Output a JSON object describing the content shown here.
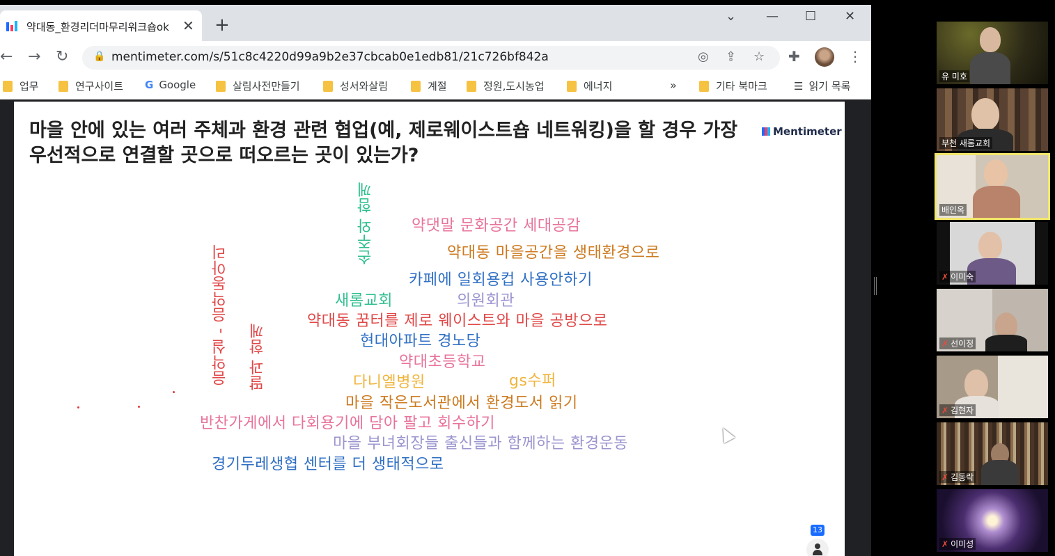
{
  "browser": {
    "tab_title": "약대동_환경리더마무리워크숍ok",
    "tab_close": "✕",
    "new_tab": "+",
    "url": "mentimeter.com/s/51c8c4220d99a9b2e37cbcab0e1edb81/21c726bf842a",
    "bookmarks": [
      {
        "label": "업무"
      },
      {
        "label": "연구사이트"
      },
      {
        "label": "Google"
      },
      {
        "label": "살림사전만들기"
      },
      {
        "label": "성서와살림"
      },
      {
        "label": "계절"
      },
      {
        "label": "정원,도시농업"
      },
      {
        "label": "에너지"
      }
    ],
    "bookmarks_more": "»",
    "other_bookmarks": "기타 북마크",
    "reading_list": "읽기 목록"
  },
  "slide": {
    "question": "마을 안에 있는 여러 주체과 환경 관련 협업(예, 제로웨이스트숍 네트워킹)을 할 경우 가장 우선적으로 연결할 곳으로 떠오르는 곳이 있는가?",
    "brand": "Mentimeter",
    "participants_count": "13",
    "words": [
      {
        "text": "약댓말 문화공간 세대공감",
        "color": "#e8739a"
      },
      {
        "text": "약대동 마을공간을 생태환경으로",
        "color": "#cc7a1f"
      },
      {
        "text": "카페에 일회용컵 사용안하기",
        "color": "#2f6fc4"
      },
      {
        "text": "새롬교회",
        "color": "#2fbf8f"
      },
      {
        "text": "의원회관",
        "color": "#9b95cf"
      },
      {
        "text": "약대동 꿈터를 제로 웨이스트와 마을 공방으로",
        "color": "#e04848"
      },
      {
        "text": "현대아파트 경노당",
        "color": "#2f6fc4"
      },
      {
        "text": "약대초등학교",
        "color": "#e8739a"
      },
      {
        "text": "다니엘병원",
        "color": "#f0b43c"
      },
      {
        "text": "gs수퍼",
        "color": "#f0b43c"
      },
      {
        "text": "마을 작은도서관에서 환경도서 읽기",
        "color": "#cc7a1f"
      },
      {
        "text": "반찬가게에서 다회용기에 담아 팔고 회수하기",
        "color": "#e8739a"
      },
      {
        "text": "마을 부녀회장들 출신들과 함께하는 환경운동",
        "color": "#9b95cf"
      },
      {
        "text": "경기두레생협 센터를 더 생태적으로",
        "color": "#2f6fc4"
      },
      {
        "text": "손주와 함께",
        "color": "#2fbf8f"
      },
      {
        "text": "음악실 - 음악동아리",
        "color": "#e04848"
      },
      {
        "text": "딸과 함께",
        "color": "#e04848"
      }
    ]
  },
  "gallery": [
    {
      "name": "유 미호",
      "muted": false
    },
    {
      "name": "부천 새롬교회",
      "muted": false
    },
    {
      "name": "배인옥",
      "muted": false
    },
    {
      "name": "이미숙",
      "muted": true
    },
    {
      "name": "선이정",
      "muted": true
    },
    {
      "name": "김현자",
      "muted": true
    },
    {
      "name": "김동락",
      "muted": true
    },
    {
      "name": "이미성",
      "muted": true
    }
  ],
  "colors": {
    "accent": "#196cff",
    "active_speaker": "#f2e66b",
    "mute": "#e74c3c"
  }
}
